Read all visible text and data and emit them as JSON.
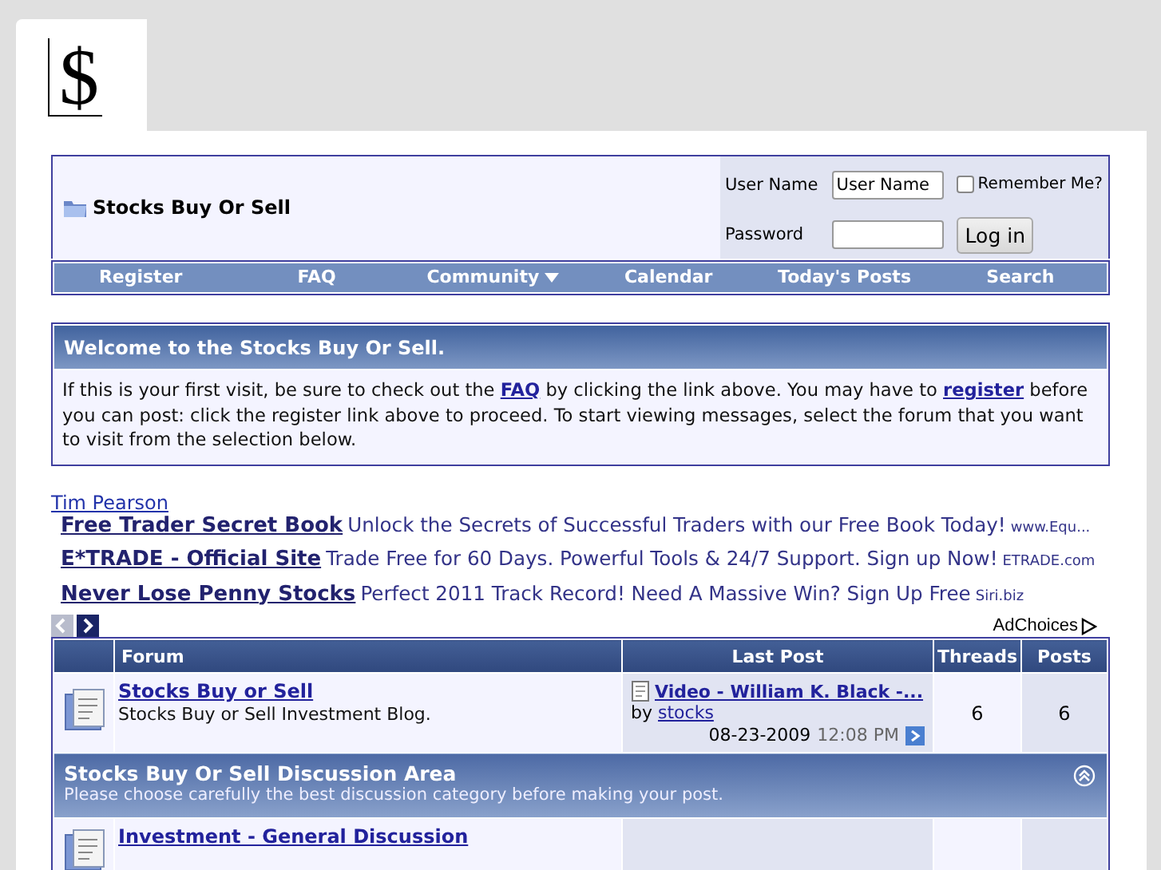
{
  "logo": {
    "text": "$"
  },
  "header": {
    "title": "Stocks Buy Or Sell"
  },
  "login": {
    "username_label": "User Name",
    "username_value": "User Name",
    "password_label": "Password",
    "remember_label": "Remember Me?",
    "remember_checked": false,
    "button": "Log in"
  },
  "nav": [
    {
      "label": "Register",
      "has_menu": false
    },
    {
      "label": "FAQ",
      "has_menu": false
    },
    {
      "label": "Community",
      "has_menu": true
    },
    {
      "label": "Calendar",
      "has_menu": false
    },
    {
      "label": "Today's Posts",
      "has_menu": false
    },
    {
      "label": "Search",
      "has_menu": false
    }
  ],
  "welcome": {
    "title": "Welcome to the Stocks Buy Or Sell.",
    "parts": [
      {
        "kind": "text",
        "text": "If this is your first visit, be sure to check out the "
      },
      {
        "kind": "link",
        "text": "FAQ"
      },
      {
        "kind": "text",
        "text": " by clicking the link above. You may have to "
      },
      {
        "kind": "link",
        "text": "register"
      },
      {
        "kind": "text",
        "text": " before you can post: click the register link above to proceed. To start viewing messages, select the forum that you want to visit from the selection below."
      }
    ]
  },
  "ads": {
    "author": "Tim Pearson",
    "items": [
      {
        "headline": "Free Trader Secret Book",
        "body": "Unlock the Secrets of Successful Traders with our Free Book Today!",
        "domain": "www.Equ..."
      },
      {
        "headline": "E*TRADE - Official Site",
        "body": "Trade Free for 60 Days. Powerful Tools & 24/7 Support. Sign up Now!",
        "domain": "ETRADE.com"
      },
      {
        "headline": "Never Lose Penny Stocks",
        "body": "Perfect 2011 Track Record! Need A Massive Win? Sign Up Free",
        "domain": "Siri.biz"
      }
    ],
    "pager": [
      {
        "kind": "prev",
        "disabled": true
      },
      {
        "kind": "next",
        "disabled": false
      }
    ],
    "ad_choices": "AdChoices"
  },
  "forum_table": {
    "columns": [
      "Forum",
      "Last Post",
      "Threads",
      "Posts"
    ],
    "rows": [
      {
        "kind": "forum",
        "title": "Stocks Buy or Sell",
        "description": "Stocks Buy or Sell Investment Blog.",
        "last_post": {
          "title": "Video - William K. Black -...",
          "by": "by",
          "author": "stocks",
          "date": "08-23-2009",
          "time": "12:08 PM"
        },
        "threads": "6",
        "posts": "6"
      },
      {
        "kind": "category",
        "title": "Stocks Buy Or Sell Discussion Area",
        "description": "Please choose carefully the best discussion category before making your post.",
        "collapsed": false
      },
      {
        "kind": "forum",
        "title": "Investment - General Discussion"
      }
    ]
  }
}
